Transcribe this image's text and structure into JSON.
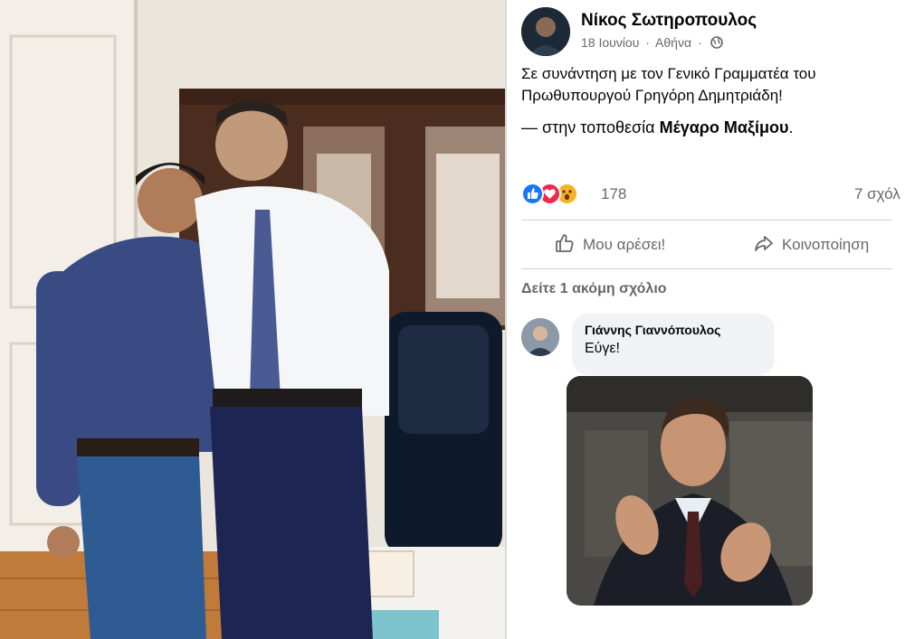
{
  "photo": {
    "icon": "meeting-photo"
  },
  "post": {
    "author": "Νίκος Σωτηροπουλος",
    "date": "18 Ιουνίου",
    "separator": "·",
    "place": "Αθήνα",
    "separator2": "·",
    "privacy_icon": "globe-icon",
    "text": "Σε συνάντηση με τον Γενικό Γραμματέα του Πρωθυπουργού Γρηγόρη Δημητριάδη!",
    "location_prefix": "— στην τοποθεσία",
    "location_name": "Μέγαρο Μαξίμου",
    "location_suffix": "."
  },
  "reactions": {
    "icons": [
      "like-icon",
      "love-icon",
      "wow-icon"
    ],
    "count": "178",
    "comments": "7 σχόλ"
  },
  "actions": {
    "like_label": "Μου αρέσει!",
    "share_label": "Κοινοποίηση"
  },
  "comments_section": {
    "more_label": "Δείτε 1 ακόμη σχόλιο",
    "items": [
      {
        "author": "Γιάννης Γιαννόπουλος",
        "text": "Εύγε!"
      }
    ],
    "gif_icon": "clapping-gif"
  },
  "colors": {
    "text": "#050505",
    "secondary": "#65676b",
    "like": "#1877f2",
    "love": "#f02849",
    "wow": "#f7b125",
    "bubble": "#f0f2f5"
  }
}
